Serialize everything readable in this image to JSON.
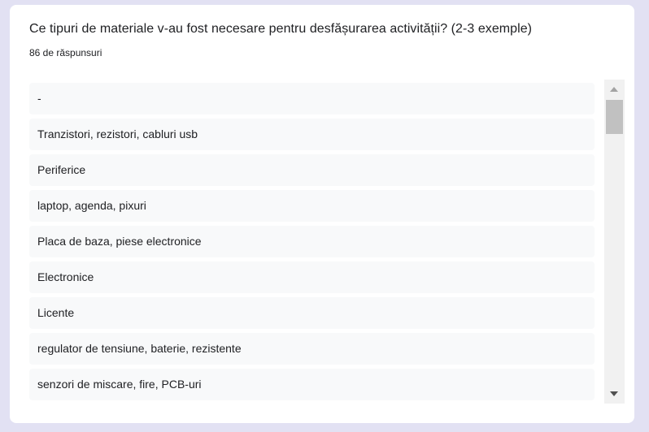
{
  "question": {
    "title": "Ce tipuri de materiale v-au fost necesare pentru desfășurarea activității? (2-3 exemple)",
    "response_count": "86 de răspunsuri"
  },
  "responses": [
    "-",
    "Tranzistori, rezistori, cabluri usb",
    "Periferice",
    "laptop, agenda, pixuri",
    "Placa de baza, piese electronice",
    "Electronice",
    "Licente",
    "regulator de tensiune, baterie, rezistente",
    "senzori de miscare, fire, PCB-uri"
  ],
  "scrollbar": {
    "up_icon": "triangle-up",
    "down_icon": "triangle-down"
  },
  "colors": {
    "page_background": "#e2e1f3",
    "card_background": "#ffffff",
    "item_background": "#f8f9fa",
    "text": "#202124"
  }
}
